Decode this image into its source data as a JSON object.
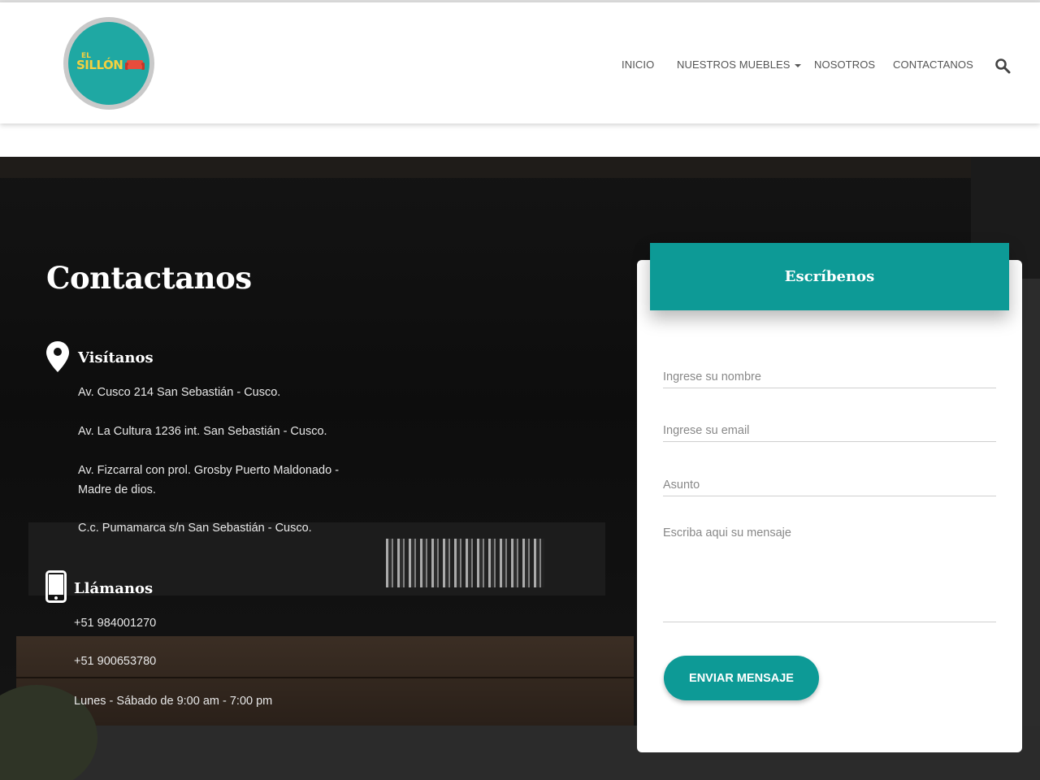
{
  "brand": {
    "logo_small": "EL",
    "logo_main": "SILLÓN"
  },
  "nav": {
    "items": [
      {
        "label": "INICIO"
      },
      {
        "label": "NUESTROS MUEBLES"
      },
      {
        "label": "NOSOTROS"
      },
      {
        "label": "CONTACTANOS"
      }
    ],
    "search_icon": "search-icon"
  },
  "contact": {
    "title": "Contactanos",
    "visit": {
      "heading": "Visítanos",
      "icon": "map-pin-icon",
      "addresses": [
        "Av. Cusco 214 San Sebastián - Cusco.",
        "Av. La Cultura 1236 int. San Sebastián - Cusco.",
        "Av. Fizcarral con prol. Grosby Puerto Maldonado -",
        "Madre de dios.",
        "C.c. Pumamarca s/n San Sebastián - Cusco."
      ]
    },
    "call": {
      "heading": "Llámanos",
      "icon": "smartphone-icon",
      "phones": [
        "+51 984001270",
        "+51 900653780"
      ],
      "hours": "Lunes - Sábado de 9:00 am - 7:00 pm"
    }
  },
  "form": {
    "title": "Escríbenos",
    "name_placeholder": "Ingrese su nombre",
    "email_placeholder": "Ingrese su email",
    "subject_placeholder": "Asunto",
    "message_placeholder": "Escriba aqui su mensaje",
    "submit_label": "ENVIAR MENSAJE"
  },
  "colors": {
    "accent": "#0d9a96",
    "logo_yellow": "#f4d03f",
    "logo_red": "#e74c3c"
  }
}
